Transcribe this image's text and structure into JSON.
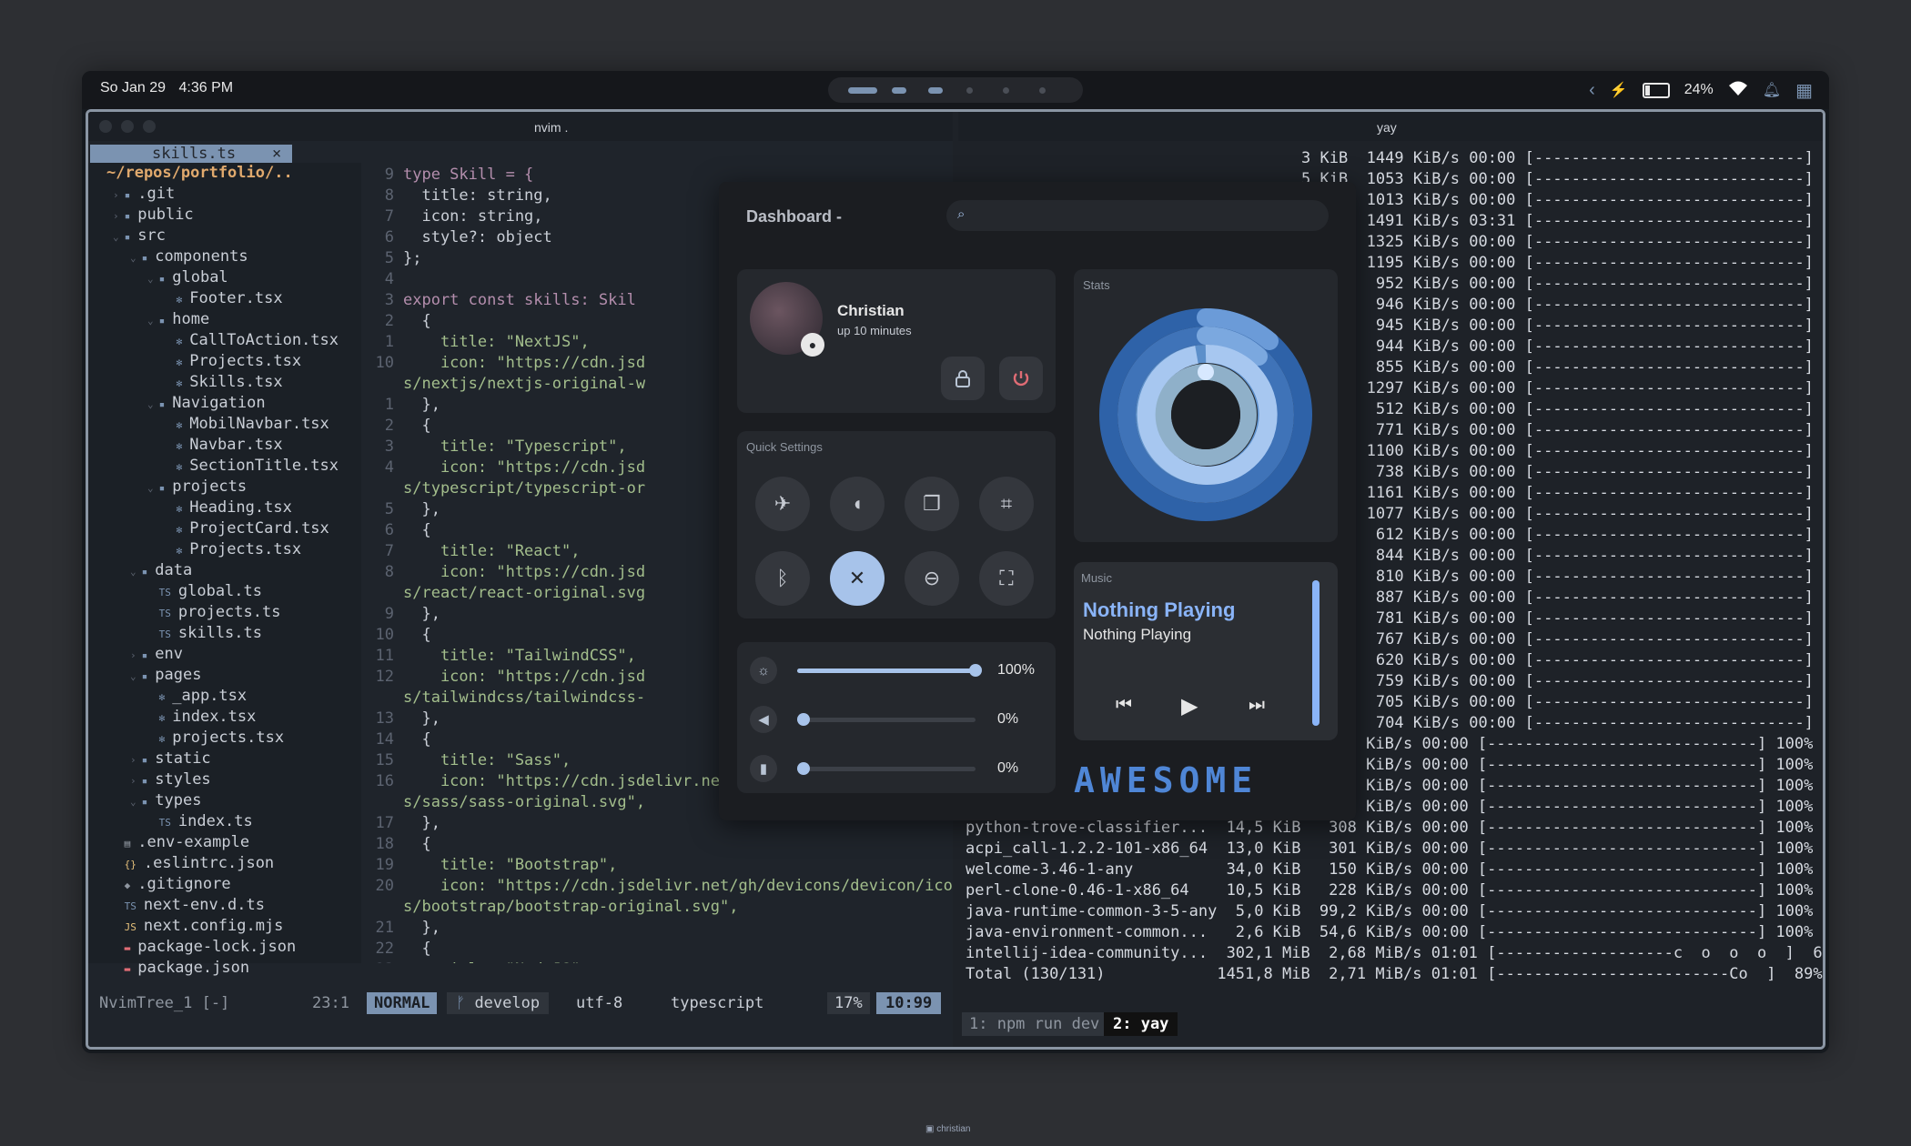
{
  "topbar": {
    "date": "So Jan 29",
    "time": "4:36 PM",
    "battery": "24%"
  },
  "left": {
    "title": "nvim .",
    "tab": "skills.ts",
    "tab_close": "×",
    "tree_root": "~/repos/portfolio/..",
    "tree": [
      {
        "label": ".git",
        "indent": 1,
        "kind": "dir",
        "open": false
      },
      {
        "label": "public",
        "indent": 1,
        "kind": "dir",
        "open": false
      },
      {
        "label": "src",
        "indent": 1,
        "kind": "dir",
        "open": true
      },
      {
        "label": "components",
        "indent": 2,
        "kind": "dir",
        "open": true
      },
      {
        "label": "global",
        "indent": 3,
        "kind": "dir",
        "open": true
      },
      {
        "label": "Footer.tsx",
        "indent": 4,
        "kind": "file"
      },
      {
        "label": "home",
        "indent": 3,
        "kind": "dir",
        "open": true
      },
      {
        "label": "CallToAction.tsx",
        "indent": 4,
        "kind": "file"
      },
      {
        "label": "Projects.tsx",
        "indent": 4,
        "kind": "file"
      },
      {
        "label": "Skills.tsx",
        "indent": 4,
        "kind": "file"
      },
      {
        "label": "Navigation",
        "indent": 3,
        "kind": "dir",
        "open": true
      },
      {
        "label": "MobilNavbar.tsx",
        "indent": 4,
        "kind": "file"
      },
      {
        "label": "Navbar.tsx",
        "indent": 4,
        "kind": "file"
      },
      {
        "label": "SectionTitle.tsx",
        "indent": 4,
        "kind": "file"
      },
      {
        "label": "projects",
        "indent": 3,
        "kind": "dir",
        "open": true
      },
      {
        "label": "Heading.tsx",
        "indent": 4,
        "kind": "file"
      },
      {
        "label": "ProjectCard.tsx",
        "indent": 4,
        "kind": "file"
      },
      {
        "label": "Projects.tsx",
        "indent": 4,
        "kind": "file"
      },
      {
        "label": "data",
        "indent": 2,
        "kind": "dir",
        "open": true
      },
      {
        "label": "global.ts",
        "indent": 3,
        "kind": "ts"
      },
      {
        "label": "projects.ts",
        "indent": 3,
        "kind": "ts"
      },
      {
        "label": "skills.ts",
        "indent": 3,
        "kind": "ts"
      },
      {
        "label": "env",
        "indent": 2,
        "kind": "dir",
        "open": false
      },
      {
        "label": "pages",
        "indent": 2,
        "kind": "dir",
        "open": true
      },
      {
        "label": "_app.tsx",
        "indent": 3,
        "kind": "file"
      },
      {
        "label": "index.tsx",
        "indent": 3,
        "kind": "file"
      },
      {
        "label": "projects.tsx",
        "indent": 3,
        "kind": "file"
      },
      {
        "label": "static",
        "indent": 2,
        "kind": "dir",
        "open": false
      },
      {
        "label": "styles",
        "indent": 2,
        "kind": "dir",
        "open": false
      },
      {
        "label": "types",
        "indent": 2,
        "kind": "dir",
        "open": true
      },
      {
        "label": "index.ts",
        "indent": 3,
        "kind": "ts"
      },
      {
        "label": ".env-example",
        "indent": 1,
        "kind": "plain"
      },
      {
        "label": ".eslintrc.json",
        "indent": 1,
        "kind": "json"
      },
      {
        "label": ".gitignore",
        "indent": 1,
        "kind": "git"
      },
      {
        "label": "next-env.d.ts",
        "indent": 1,
        "kind": "ts"
      },
      {
        "label": "next.config.mjs",
        "indent": 1,
        "kind": "js"
      },
      {
        "label": "package-lock.json",
        "indent": 1,
        "kind": "npm"
      },
      {
        "label": "package.json",
        "indent": 1,
        "kind": "npm"
      }
    ],
    "code": [
      {
        "n": "9",
        "t": "type Skill = {"
      },
      {
        "n": "8",
        "t": "  title: string,"
      },
      {
        "n": "7",
        "t": "  icon: string,"
      },
      {
        "n": "6",
        "t": "  style?: object"
      },
      {
        "n": "5",
        "t": "};"
      },
      {
        "n": "4",
        "t": ""
      },
      {
        "n": "3",
        "t": "export const skills: Skil"
      },
      {
        "n": "2",
        "t": "  {"
      },
      {
        "n": "1",
        "t": "    title: \"NextJS\","
      },
      {
        "n": "10",
        "t": "    icon: \"https://cdn.jsd"
      },
      {
        "n": "",
        "t": "s/nextjs/nextjs-original-w"
      },
      {
        "n": "1",
        "t": "  },"
      },
      {
        "n": "2",
        "t": "  {"
      },
      {
        "n": "3",
        "t": "    title: \"Typescript\","
      },
      {
        "n": "4",
        "t": "    icon: \"https://cdn.jsd"
      },
      {
        "n": "",
        "t": "s/typescript/typescript-or"
      },
      {
        "n": "5",
        "t": "  },"
      },
      {
        "n": "6",
        "t": "  {"
      },
      {
        "n": "7",
        "t": "    title: \"React\","
      },
      {
        "n": "8",
        "t": "    icon: \"https://cdn.jsd"
      },
      {
        "n": "",
        "t": "s/react/react-original.svg"
      },
      {
        "n": "9",
        "t": "  },"
      },
      {
        "n": "10",
        "t": "  {"
      },
      {
        "n": "11",
        "t": "    title: \"TailwindCSS\","
      },
      {
        "n": "12",
        "t": "    icon: \"https://cdn.jsd"
      },
      {
        "n": "",
        "t": "s/tailwindcss/tailwindcss-"
      },
      {
        "n": "13",
        "t": "  },"
      },
      {
        "n": "14",
        "t": "  {"
      },
      {
        "n": "15",
        "t": "    title: \"Sass\","
      },
      {
        "n": "16",
        "t": "    icon: \"https://cdn.jsdelivr.net/gh/devicons/devicon/icon"
      },
      {
        "n": "",
        "t": "s/sass/sass-original.svg\","
      },
      {
        "n": "17",
        "t": "  },"
      },
      {
        "n": "18",
        "t": "  {"
      },
      {
        "n": "19",
        "t": "    title: \"Bootstrap\","
      },
      {
        "n": "20",
        "t": "    icon: \"https://cdn.jsdelivr.net/gh/devicons/devicon/icon"
      },
      {
        "n": "",
        "t": "s/bootstrap/bootstrap-original.svg\","
      },
      {
        "n": "21",
        "t": "  },"
      },
      {
        "n": "22",
        "t": "  {"
      },
      {
        "n": "23",
        "t": "    title: \"NodeJS\","
      }
    ],
    "status": {
      "tree_name": "NvimTree_1 [-]",
      "tree_pos": "23:1",
      "mode": "NORMAL",
      "branch": "develop",
      "encoding": "utf-8",
      "filetype": "typescript",
      "percent": "17%",
      "position": "10:99"
    }
  },
  "right": {
    "title": "yay",
    "rows": [
      {
        "t": "3 KiB  1449 KiB/s 00:00 [-----------------------------] 100%"
      },
      {
        "t": "5 KiB  1053 KiB/s 00:00 [-----------------------------] 100%"
      },
      {
        "t": "5 KiB  1013 KiB/s 00:00 [-----------------------------] 100%"
      },
      {
        "t": "9 MiB  1491 KiB/s 03:31 [-----------------------------] 100%"
      },
      {
        "t": "3 KiB  1325 KiB/s 00:00 [-----------------------------] 100%"
      },
      {
        "t": "1 KiB  1195 KiB/s 00:00 [-----------------------------] 100%"
      },
      {
        "t": "2 KiB   952 KiB/s 00:00 [-----------------------------] 100%"
      },
      {
        "t": "3 KiB   946 KiB/s 00:00 [-----------------------------] 100%"
      },
      {
        "t": "5 KiB   945 KiB/s 00:00 [-----------------------------] 100%"
      },
      {
        "t": "3 KiB   944 KiB/s 00:00 [-----------------------------] 100%"
      },
      {
        "t": "3 KiB   855 KiB/s 00:00 [-----------------------------] 100%"
      },
      {
        "t": "9 KiB  1297 KiB/s 00:00 [-----------------------------] 100%"
      },
      {
        "t": "1 KiB   512 KiB/s 00:00 [-----------------------------] 100%"
      },
      {
        "t": "7 KiB   771 KiB/s 00:00 [-----------------------------] 100%"
      },
      {
        "t": "3 KiB  1100 KiB/s 00:00 [-----------------------------] 100%"
      },
      {
        "t": "5 KiB   738 KiB/s 00:00 [-----------------------------] 100%"
      },
      {
        "t": "1 KiB  1161 KiB/s 00:00 [-----------------------------] 100%"
      },
      {
        "t": "3 KiB  1077 KiB/s 00:00 [-----------------------------] 100%"
      },
      {
        "t": "3 KiB   612 KiB/s 00:00 [-----------------------------] 100%"
      },
      {
        "t": "2 KiB   844 KiB/s 00:00 [-----------------------------] 100%"
      },
      {
        "t": "1 KiB   810 KiB/s 00:00 [-----------------------------] 100%"
      },
      {
        "t": "3 KiB   887 KiB/s 00:00 [-----------------------------] 100%"
      },
      {
        "t": "4 KiB   781 KiB/s 00:00 [-----------------------------] 100%"
      },
      {
        "t": "3 KiB   767 KiB/s 00:00 [-----------------------------] 100%"
      },
      {
        "t": "2 KiB   620 KiB/s 00:00 [-----------------------------] 100%"
      },
      {
        "t": "7 KiB   759 KiB/s 00:00 [-----------------------------] 100%"
      },
      {
        "t": "3 KiB   705 KiB/s 00:00 [-----------------------------] 100%"
      },
      {
        "t": "3 KiB   704 KiB/s 00:00 [-----------------------------] 100%"
      },
      {
        "t": "msgpack-c-3.0.0-1-x86_64    10,2 KiB   540 KiB/s 00:00 [-----------------------------] 100%"
      },
      {
        "t": "linux-firmware-whence-2...  30,0 KiB   600 KiB/s 00:00 [-----------------------------] 100%"
      },
      {
        "t": "b43-fwcutter-019-4-x86_64   19,2 KiB   363 KiB/s 00:00 [-----------------------------] 100%"
      },
      {
        "t": "endeavouros-skel-defaul...  17,4 KiB   377 KiB/s 00:00 [-----------------------------] 100%"
      },
      {
        "t": "python-trove-classifier...  14,5 KiB   308 KiB/s 00:00 [-----------------------------] 100%"
      },
      {
        "t": "acpi_call-1.2.2-101-x86_64  13,0 KiB   301 KiB/s 00:00 [-----------------------------] 100%"
      },
      {
        "t": "welcome-3.46-1-any          34,0 KiB   150 KiB/s 00:00 [-----------------------------] 100%"
      },
      {
        "t": "perl-clone-0.46-1-x86_64    10,5 KiB   228 KiB/s 00:00 [-----------------------------] 100%"
      },
      {
        "t": "java-runtime-common-3-5-any  5,0 KiB  99,2 KiB/s 00:00 [-----------------------------] 100%"
      },
      {
        "t": "java-environment-common...   2,6 KiB  54,6 KiB/s 00:00 [-----------------------------] 100%"
      },
      {
        "t": "intellij-idea-community...  302,1 MiB  2,68 MiB/s 01:01 [-------------------c  o  o  o  ]  64%"
      },
      {
        "t": "Total (130/131)            1451,8 MiB  2,71 MiB/s 01:01 [-------------------------Co  ]  89%"
      }
    ],
    "tmux_win1": "1: npm run dev",
    "tmux_win2": "2: yay"
  },
  "dashboard": {
    "title": "Dashboard -",
    "search_placeholder": "",
    "user_name": "Christian",
    "uptime": "up 10 minutes",
    "quick_settings_label": "Quick Settings",
    "stats_label": "Stats",
    "music_label": "Music",
    "music_title": "Nothing Playing",
    "music_artist": "Nothing Playing",
    "brightness_pct": "100%",
    "volume_pct": "0%",
    "mic_pct": "0%",
    "brightness_level": 1.0,
    "volume_level": 0.0,
    "mic_level": 0.0,
    "banner_text": "AWESOME"
  },
  "footer": {
    "text": "christian"
  },
  "colors": {
    "accent": "#7b93b1",
    "slider": "#a7c3ea",
    "power": "#e06c75",
    "ring_outer": "#2e62a8",
    "ring_inner": "#8ab4f8"
  }
}
